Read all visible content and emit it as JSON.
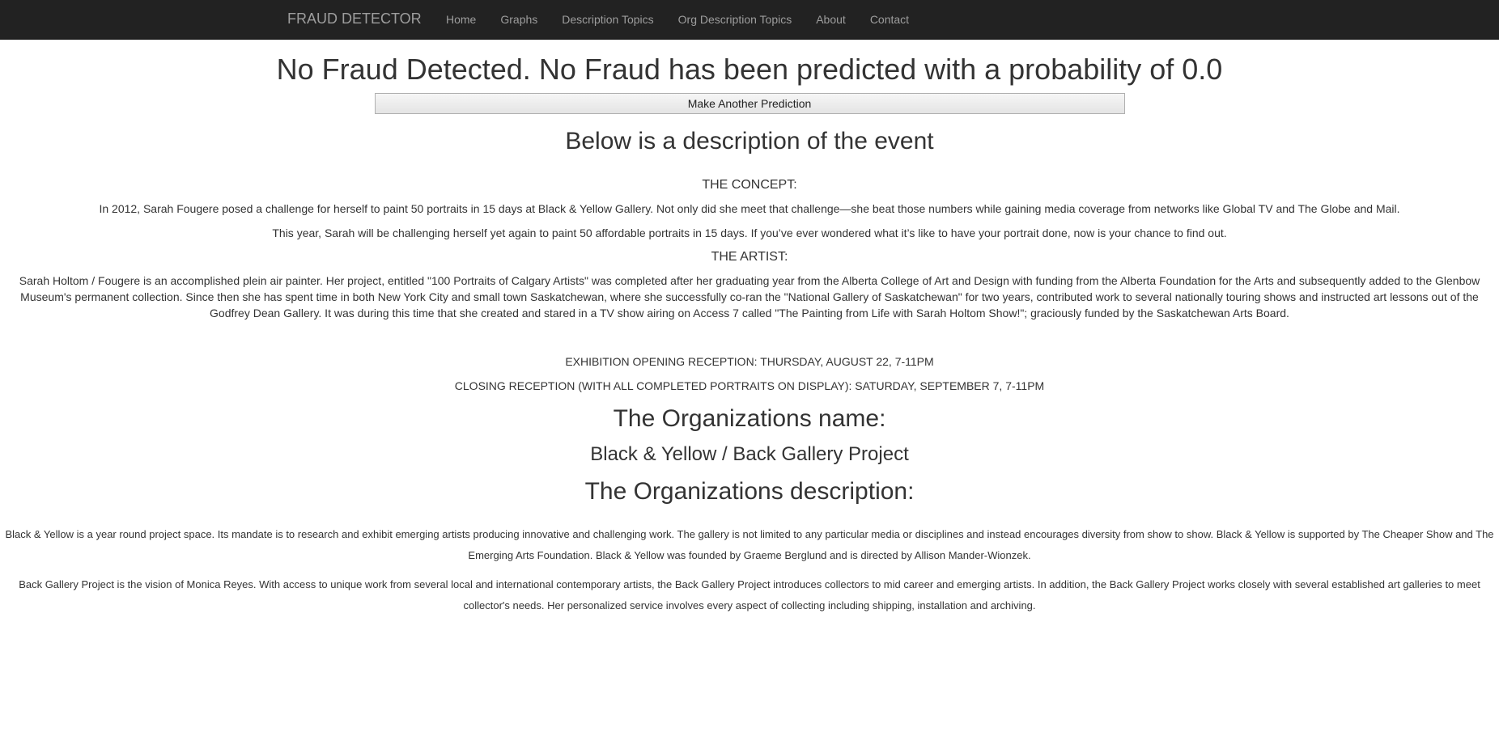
{
  "navbar": {
    "brand": "FRAUD DETECTOR",
    "links": [
      "Home",
      "Graphs",
      "Description Topics",
      "Org Description Topics",
      "About",
      "Contact"
    ]
  },
  "result": {
    "headline": "No Fraud Detected. No Fraud has been predicted with a probability of 0.0",
    "button_label": "Make Another Prediction"
  },
  "event": {
    "heading": "Below is a description of the event",
    "concept_heading": "THE CONCEPT:",
    "concept_p1": "In 2012, Sarah Fougere posed a challenge for herself to paint 50 portraits in 15 days at Black & Yellow Gallery. Not only did she meet that challenge—she beat those numbers while gaining media coverage from networks like Global TV and The Globe and Mail.",
    "concept_p2": "This year, Sarah will be challenging herself yet again to paint 50 affordable portraits in 15 days. If you’ve ever wondered what it’s like to have your portrait done, now is your chance to find out.",
    "artist_heading": "THE ARTIST:",
    "artist_p": "Sarah Holtom / Fougere is an accomplished plein air painter. Her project, entitled \"100 Portraits of Calgary Artists\" was completed after her graduating year from the Alberta College of Art and Design with funding from the Alberta Foundation for the Arts and subsequently added to the Glenbow Museum's permanent collection. Since then she has spent time in both New York City and small town Saskatchewan, where she successfully co-ran the \"National Gallery of Saskatchewan\" for two years, contributed work to several nationally touring shows and instructed art lessons out of the Godfrey Dean Gallery. It was during this time that she created and stared in a TV show airing on Access 7 called \"The Painting from Life with Sarah Holtom Show!\"; graciously funded by the Saskatchewan Arts Board.",
    "opening": "EXHIBITION OPENING RECEPTION: THURSDAY, AUGUST 22, 7-11PM",
    "closing": "CLOSING RECEPTION (WITH ALL COMPLETED PORTRAITS ON DISPLAY): SATURDAY, SEPTEMBER 7, 7-11PM"
  },
  "organization": {
    "name_heading": "The Organizations name:",
    "name": "Black & Yellow / Back Gallery Project",
    "desc_heading": "The Organizations description:",
    "desc_p1": "Black & Yellow is a year round project space. Its mandate is to research and exhibit emerging artists producing innovative and challenging work. The gallery is not limited to any particular media or disciplines and instead encourages diversity from show to show. Black & Yellow is supported by The Cheaper Show and The Emerging Arts Foundation.  Black & Yellow was founded by Graeme Berglund and is directed by Allison Mander-Wionzek.",
    "desc_p2": "Back Gallery Project is the vision of Monica Reyes. With access to unique work from several local and international contemporary artists, the Back Gallery Project introduces collectors to mid career and emerging artists.  In addition, the Back Gallery Project works closely with several established art galleries to meet collector's needs. Her personalized service involves every aspect of collecting including shipping, installation and archiving."
  }
}
